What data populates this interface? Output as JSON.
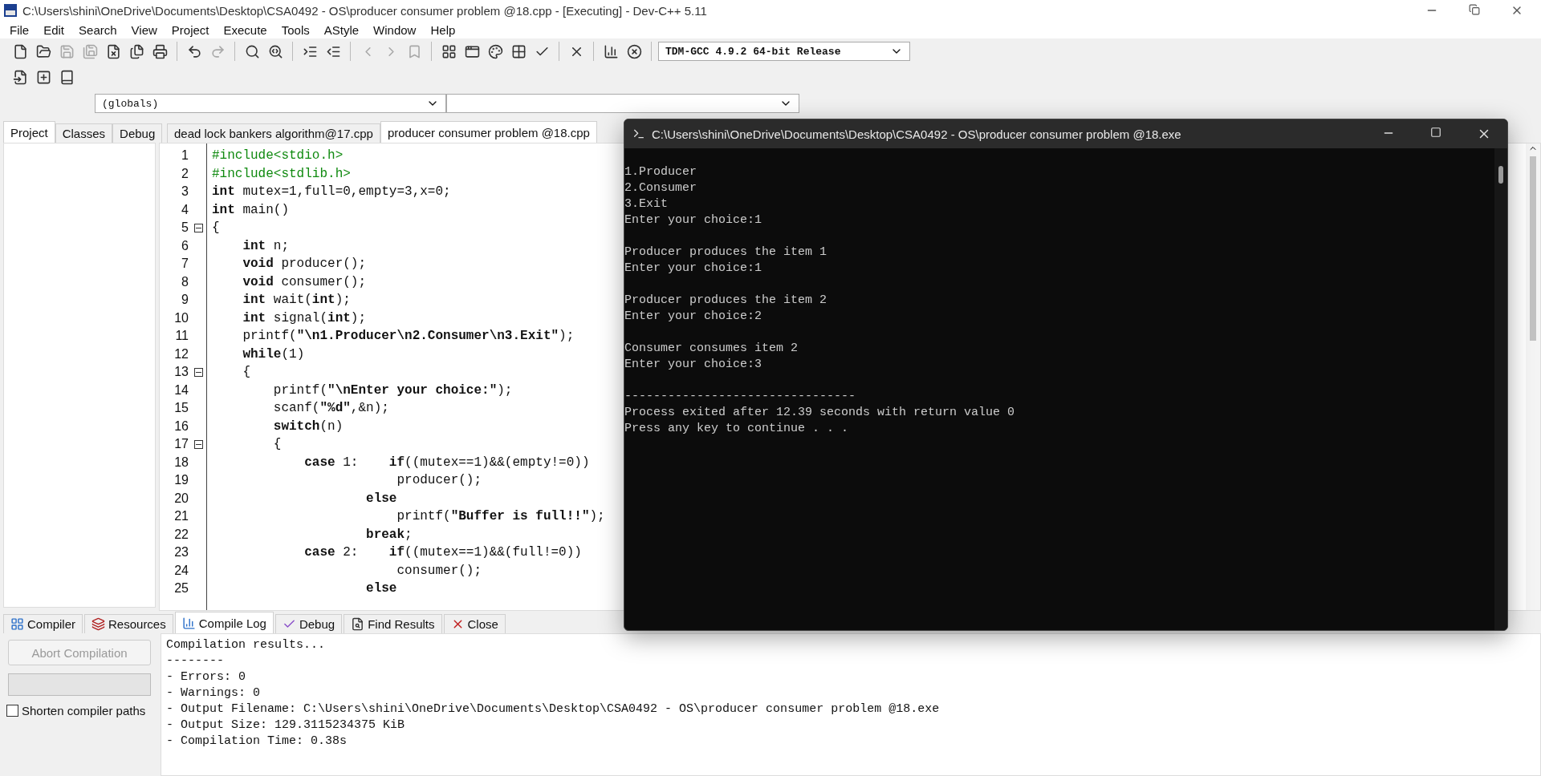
{
  "window": {
    "title": "C:\\Users\\shini\\OneDrive\\Documents\\Desktop\\CSA0492 - OS\\producer consumer problem @18.cpp - [Executing] - Dev-C++ 5.11"
  },
  "menu": [
    "File",
    "Edit",
    "Search",
    "View",
    "Project",
    "Execute",
    "Tools",
    "AStyle",
    "Window",
    "Help"
  ],
  "toolbar": [
    [
      {
        "disabled": false
      },
      {
        "disabled": false
      },
      {
        "disabled": true
      },
      {
        "disabled": true
      },
      {
        "disabled": false
      },
      {
        "disabled": false
      },
      {
        "disabled": false
      }
    ],
    [
      {
        "disabled": false
      },
      {
        "disabled": true
      }
    ],
    [
      {
        "disabled": false
      },
      {
        "disabled": false
      }
    ],
    [
      {
        "disabled": false
      },
      {
        "disabled": false
      }
    ],
    [
      {
        "disabled": true
      },
      {
        "disabled": true
      },
      {
        "disabled": true
      }
    ],
    [
      {
        "disabled": false
      },
      {
        "disabled": false
      },
      {
        "disabled": false
      },
      {
        "disabled": false
      },
      {
        "disabled": false
      }
    ],
    [
      {
        "disabled": false
      }
    ],
    [
      {
        "disabled": false
      },
      {
        "disabled": false
      }
    ]
  ],
  "compiler_select": {
    "value": "TDM-GCC 4.9.2 64-bit Release"
  },
  "toolbar_2": [
    {
      "disabled": false
    },
    {
      "disabled": false
    },
    {
      "disabled": false
    }
  ],
  "scope_select": {
    "value": "(globals)"
  },
  "left_tabs": [
    {
      "label": "Project",
      "selected": true
    },
    {
      "label": "Classes",
      "selected": false
    },
    {
      "label": "Debug",
      "selected": false
    }
  ],
  "editor_tabs": [
    {
      "label": "dead lock bankers algorithm@17.cpp",
      "selected": false
    },
    {
      "label": "producer consumer problem @18.cpp",
      "selected": true
    }
  ],
  "code": [
    {
      "number": "1",
      "kind": "preprocessor",
      "fold": false,
      "text": "#include<stdio.h>"
    },
    {
      "number": "2",
      "kind": "preprocessor",
      "fold": false,
      "text": "#include<stdlib.h>"
    },
    {
      "number": "3",
      "kind": "code",
      "fold": false,
      "text": "**int** mutex=1,full=0,empty=3,x=0;"
    },
    {
      "number": "4",
      "kind": "code",
      "fold": false,
      "text": "**int** main()"
    },
    {
      "number": "5",
      "kind": "code",
      "fold": true,
      "text": "{"
    },
    {
      "number": "6",
      "kind": "code",
      "fold": false,
      "text": "    **int** n;"
    },
    {
      "number": "7",
      "kind": "code",
      "fold": false,
      "text": "    **void** producer();"
    },
    {
      "number": "8",
      "kind": "code",
      "fold": false,
      "text": "    **void** consumer();"
    },
    {
      "number": "9",
      "kind": "code",
      "fold": false,
      "text": "    **int** wait(**int**);"
    },
    {
      "number": "10",
      "kind": "code",
      "fold": false,
      "text": "    **int** signal(**int**);"
    },
    {
      "number": "11",
      "kind": "code",
      "fold": false,
      "text": "    printf(**\"\\n1.Producer\\n2.Consumer\\n3.Exit\"**);"
    },
    {
      "number": "12",
      "kind": "code",
      "fold": false,
      "text": "    **while**(1)"
    },
    {
      "number": "13",
      "kind": "code",
      "fold": true,
      "text": "    {"
    },
    {
      "number": "14",
      "kind": "code",
      "fold": false,
      "text": "        printf(**\"\\nEnter your choice:\"**);"
    },
    {
      "number": "15",
      "kind": "code",
      "fold": false,
      "text": "        scanf(**\"%d\"**,&n);"
    },
    {
      "number": "16",
      "kind": "code",
      "fold": false,
      "text": "        **switch**(n)"
    },
    {
      "number": "17",
      "kind": "code",
      "fold": true,
      "text": "        {"
    },
    {
      "number": "18",
      "kind": "code",
      "fold": false,
      "text": "            **case** 1:    **if**((mutex==1)&&(empty!=0))"
    },
    {
      "number": "19",
      "kind": "code",
      "fold": false,
      "text": "                        producer();"
    },
    {
      "number": "20",
      "kind": "code",
      "fold": false,
      "text": "                    **else**"
    },
    {
      "number": "21",
      "kind": "code",
      "fold": false,
      "text": "                        printf(**\"Buffer is full!!\"**);"
    },
    {
      "number": "22",
      "kind": "code",
      "fold": false,
      "text": "                    **break**;"
    },
    {
      "number": "23",
      "kind": "code",
      "fold": false,
      "text": "            **case** 2:    **if**((mutex==1)&&(full!=0))"
    },
    {
      "number": "24",
      "kind": "code",
      "fold": false,
      "text": "                        consumer();"
    },
    {
      "number": "25",
      "kind": "code",
      "fold": false,
      "text": "                    **else**"
    }
  ],
  "bottom_tabs": [
    {
      "label": "Compiler",
      "selected": false
    },
    {
      "label": "Resources",
      "selected": false
    },
    {
      "label": "Compile Log",
      "selected": true
    },
    {
      "label": "Debug",
      "selected": false
    },
    {
      "label": "Find Results",
      "selected": false
    },
    {
      "label": "Close",
      "selected": false
    }
  ],
  "progress_bar": {
    "level": 0
  },
  "abort_button": {
    "label": "Abort Compilation",
    "disabled": true
  },
  "shorten_paths": {
    "label": "Shorten compiler paths",
    "checked": false
  },
  "compile_log": [
    "Compilation results...",
    "--------",
    "- Errors: 0",
    "- Warnings: 0",
    "- Output Filename: C:\\Users\\shini\\OneDrive\\Documents\\Desktop\\CSA0492 - OS\\producer consumer problem @18.exe",
    "- Output Size: 129.3115234375 KiB",
    "- Compilation Time: 0.38s"
  ],
  "console": {
    "title": "C:\\Users\\shini\\OneDrive\\Documents\\Desktop\\CSA0492 - OS\\producer consumer problem @18.exe",
    "blocks": [
      [
        "1.Producer",
        "2.Consumer",
        "3.Exit",
        "Enter your choice:1"
      ],
      [
        "Producer produces the item 1",
        "Enter your choice:1"
      ],
      [
        "Producer produces the item 2",
        "Enter your choice:2"
      ],
      [
        "Consumer consumes item 2",
        "Enter your choice:3"
      ],
      [
        "--------------------------------",
        "Process exited after 12.39 seconds with return value 0",
        "Press any key to continue . . ."
      ]
    ]
  }
}
